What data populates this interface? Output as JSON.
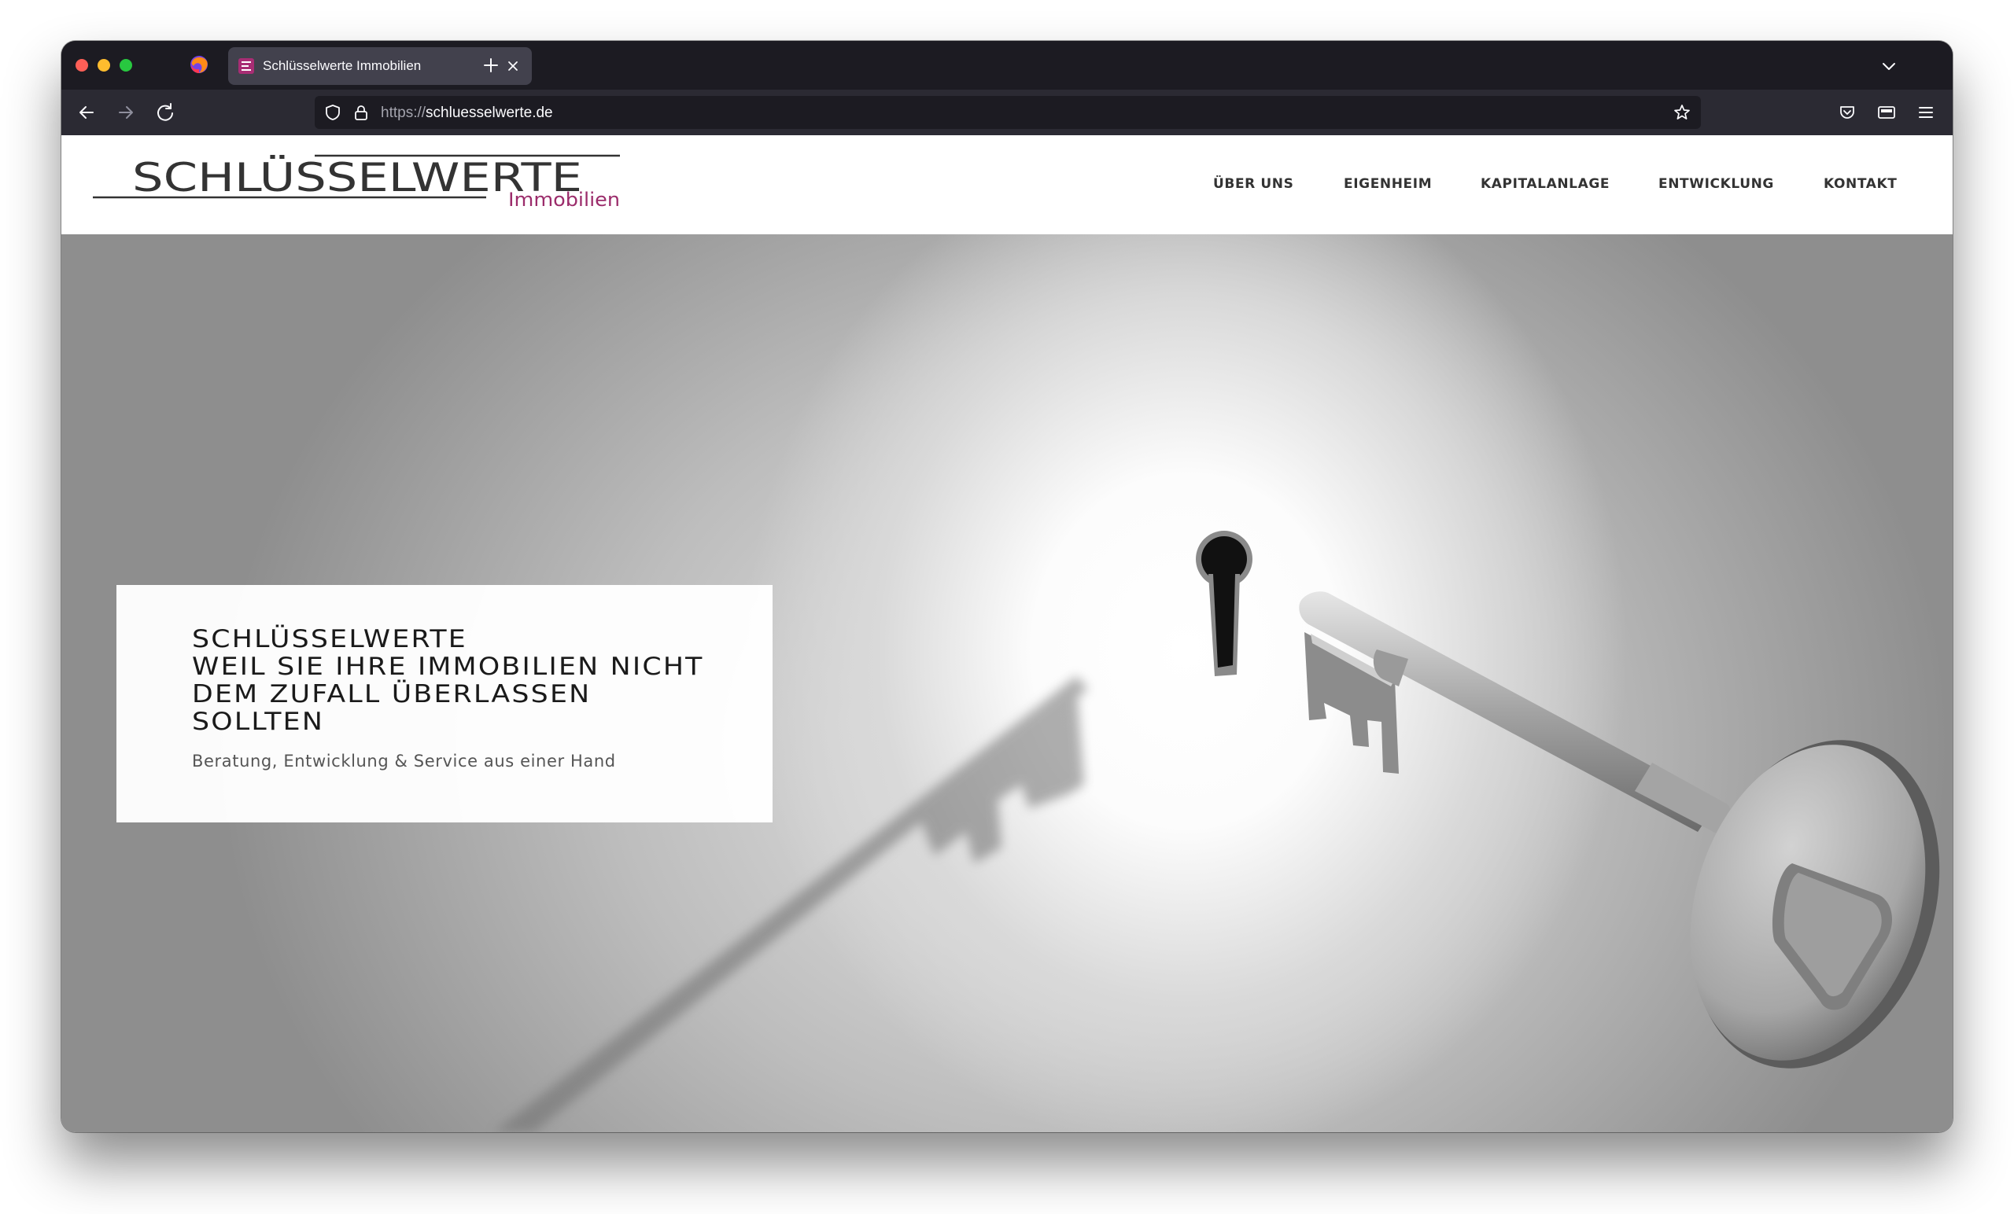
{
  "browser": {
    "tab": {
      "title": "Schlüsselwerte Immobilien"
    },
    "url": {
      "protocol": "https://",
      "host": "schluesselwerte.de"
    },
    "icons": [
      "firefox-icon",
      "back-icon",
      "forward-icon",
      "reload-icon",
      "shield-icon",
      "lock-icon",
      "bookmark-star-icon",
      "pocket-icon",
      "reader-view-icon",
      "menu-icon",
      "list-all-tabs-icon",
      "new-tab-icon",
      "close-icon"
    ]
  },
  "site": {
    "logo": {
      "name": "SCHLÜSSELWERTE",
      "sub": "Immobilien"
    },
    "nav": {
      "items": [
        {
          "label": "ÜBER UNS"
        },
        {
          "label": "EIGENHEIM"
        },
        {
          "label": "KAPITALANLAGE"
        },
        {
          "label": "ENTWICKLUNG"
        },
        {
          "label": "KONTAKT"
        }
      ]
    },
    "hero": {
      "title_lines": [
        "SCHLÜSSELWERTE",
        "WEIL SIE IHRE IMMOBILIEN NICHT",
        "DEM ZUFALL ÜBERLASSEN",
        "SOLLTEN"
      ],
      "subtitle": "Beratung, Entwicklung & Service aus einer Hand"
    },
    "colors": {
      "accent": "#9b2c6b",
      "nav_text": "#333333"
    }
  }
}
